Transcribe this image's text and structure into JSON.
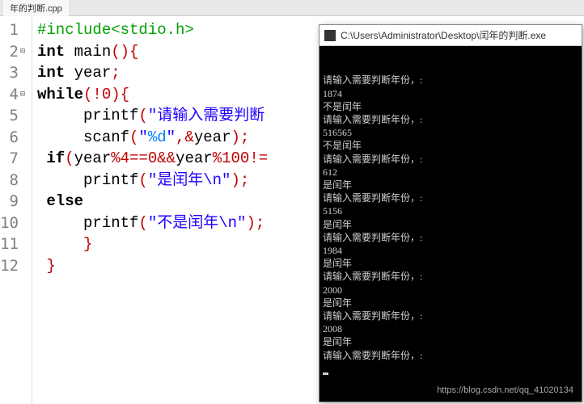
{
  "tab": {
    "label": "年的判断.cpp"
  },
  "editor": {
    "lines": [
      {
        "n": 1,
        "fold": "",
        "tokens": [
          [
            "tok-pre",
            "#include<stdio.h>"
          ]
        ]
      },
      {
        "n": 2,
        "fold": "⊟",
        "tokens": [
          [
            "tok-kw",
            "int"
          ],
          [
            "tok-id",
            " main"
          ],
          [
            "tok-pn",
            "(){"
          ]
        ]
      },
      {
        "n": 3,
        "fold": "",
        "tokens": [
          [
            "tok-kw",
            "int"
          ],
          [
            "tok-id",
            " year"
          ],
          [
            "tok-pn",
            ";"
          ]
        ]
      },
      {
        "n": 4,
        "fold": "⊟",
        "tokens": [
          [
            "tok-kw",
            "while"
          ],
          [
            "tok-pn",
            "(!"
          ],
          [
            "tok-num",
            "0"
          ],
          [
            "tok-pn",
            "){"
          ]
        ]
      },
      {
        "n": 5,
        "fold": "",
        "tokens": [
          [
            "tok-id",
            "     printf"
          ],
          [
            "tok-pn",
            "("
          ],
          [
            "tok-str",
            "\"请输入需要判断"
          ]
        ]
      },
      {
        "n": 6,
        "fold": "",
        "tokens": [
          [
            "tok-id",
            "     scanf"
          ],
          [
            "tok-pn",
            "("
          ],
          [
            "tok-str",
            "\""
          ],
          [
            "tok-fmt",
            "%d"
          ],
          [
            "tok-str",
            "\""
          ],
          [
            "tok-pn",
            ","
          ],
          [
            "tok-pn",
            "&"
          ],
          [
            "tok-id",
            "year"
          ],
          [
            "tok-pn",
            ");"
          ]
        ]
      },
      {
        "n": 7,
        "fold": "",
        "tokens": [
          [
            "tok-kw",
            " if"
          ],
          [
            "tok-pn",
            "("
          ],
          [
            "tok-id",
            "year"
          ],
          [
            "tok-pn",
            "%"
          ],
          [
            "tok-num",
            "4"
          ],
          [
            "tok-pn",
            "=="
          ],
          [
            "tok-num",
            "0"
          ],
          [
            "tok-pn",
            "&&"
          ],
          [
            "tok-id",
            "year"
          ],
          [
            "tok-pn",
            "%"
          ],
          [
            "tok-num",
            "100"
          ],
          [
            "tok-pn",
            "!="
          ]
        ]
      },
      {
        "n": 8,
        "fold": "",
        "tokens": [
          [
            "tok-id",
            "     printf"
          ],
          [
            "tok-pn",
            "("
          ],
          [
            "tok-str",
            "\"是闰年\\n\""
          ],
          [
            "tok-pn",
            ");"
          ]
        ]
      },
      {
        "n": 9,
        "fold": "",
        "tokens": [
          [
            "tok-kw",
            " else"
          ]
        ]
      },
      {
        "n": 10,
        "fold": "",
        "tokens": [
          [
            "tok-id",
            "     printf"
          ],
          [
            "tok-pn",
            "("
          ],
          [
            "tok-str",
            "\"不是闰年\\n\""
          ],
          [
            "tok-pn",
            ");"
          ]
        ]
      },
      {
        "n": 11,
        "fold": "",
        "tokens": [
          [
            "tok-pn",
            "     }"
          ]
        ]
      },
      {
        "n": 12,
        "fold": "",
        "tokens": [
          [
            "tok-pn",
            " }"
          ]
        ]
      }
    ]
  },
  "console": {
    "title": "C:\\Users\\Administrator\\Desktop\\闰年的判断.exe",
    "lines": [
      "请输入需要判断年份，:",
      "1874",
      "不是闰年",
      "请输入需要判断年份，:",
      "516565",
      "不是闰年",
      "请输入需要判断年份，:",
      "612",
      "是闰年",
      "请输入需要判断年份，:",
      "5156",
      "是闰年",
      "请输入需要判断年份，:",
      "1984",
      "是闰年",
      "请输入需要判断年份，:",
      "2000",
      "是闰年",
      "请输入需要判断年份，:",
      "2008",
      "是闰年",
      "请输入需要判断年份，:"
    ]
  },
  "watermark": "https://blog.csdn.net/qq_41020134"
}
